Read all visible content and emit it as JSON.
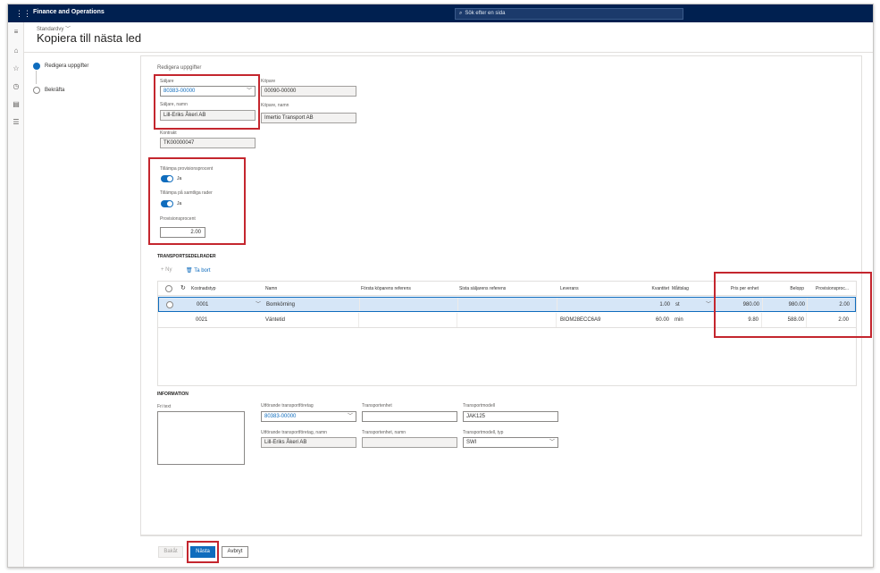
{
  "app": {
    "title": "Finance and Operations",
    "search_placeholder": "Sök efter en sida"
  },
  "header": {
    "view_name": "Standardvy",
    "page_title": "Kopiera till nästa led"
  },
  "rail_icons": [
    "hamburger-icon",
    "home-icon",
    "star-icon",
    "clock-icon",
    "workspace-icon",
    "list-icon"
  ],
  "steps": [
    {
      "label": "Redigera uppgifter",
      "state": "active"
    },
    {
      "label": "Bekräfta",
      "state": "todo"
    }
  ],
  "form": {
    "section_title": "Redigera uppgifter",
    "seller_label": "Säljare",
    "seller_value": "80383-00000",
    "buyer_label": "Köpare",
    "buyer_value": "00090-00000",
    "seller_name_label": "Säljare, namn",
    "seller_name_value": "Lill-Eriks Åkeri AB",
    "buyer_name_label": "Köpare, namn",
    "buyer_name_value": "Imertio Transport AB",
    "contract_label": "Kontrakt",
    "contract_value": "TK00000047",
    "apply_commission_label": "Tillämpa provisionsprocent",
    "apply_commission_value": "Ja",
    "apply_all_rows_label": "Tillämpa på samtliga rader",
    "apply_all_rows_value": "Ja",
    "commission_pct_label": "Provisionsprocent",
    "commission_pct_value": "2.00"
  },
  "lines": {
    "section_title": "TRANSPORTSEDELRADER",
    "new_label": "Ny",
    "delete_label": "Ta bort",
    "columns": [
      "Kostnadstyp",
      "Namn",
      "Första köparens referens",
      "Sista säljarens referens",
      "Leverans",
      "Kvantitet",
      "Måttslag",
      "Pris per enhet",
      "Belopp",
      "Provisionsproc..."
    ],
    "rows": [
      {
        "cost_type": "0001",
        "name": "Bomkörning",
        "first_ref": "",
        "last_ref": "",
        "delivery": "",
        "qty": "1.00",
        "unit": "st",
        "price": "980.00",
        "amount": "980.00",
        "commission": "2.00"
      },
      {
        "cost_type": "0021",
        "name": "Väntetid",
        "first_ref": "",
        "last_ref": "",
        "delivery": "BIOM28ECC6A9",
        "qty": "60.00",
        "unit": "min",
        "price": "9.80",
        "amount": "588.00",
        "commission": "2.00"
      }
    ]
  },
  "information": {
    "section_title": "INFORMATION",
    "free_text_label": "Fri text",
    "carrier_label": "Utförande transportföretag",
    "carrier_value": "80383-00000",
    "carrier_name_label": "Utförande transportföretag, namn",
    "carrier_name_value": "Lill-Eriks Åkeri AB",
    "transport_unit_label": "Transportenhet",
    "transport_unit_value": "",
    "transport_unit_name_label": "Transportenhet, namn",
    "transport_unit_name_value": "",
    "transport_model_label": "Transportmodell",
    "transport_model_value": "JAK125",
    "transport_model_type_label": "Transportmodell, typ",
    "transport_model_type_value": "SWI"
  },
  "footer": {
    "back_label": "Bakåt",
    "next_label": "Nästa",
    "cancel_label": "Avbryt"
  },
  "colors": {
    "topbar": "#002050",
    "accent": "#0f6cbd",
    "highlight": "#c4262e"
  }
}
